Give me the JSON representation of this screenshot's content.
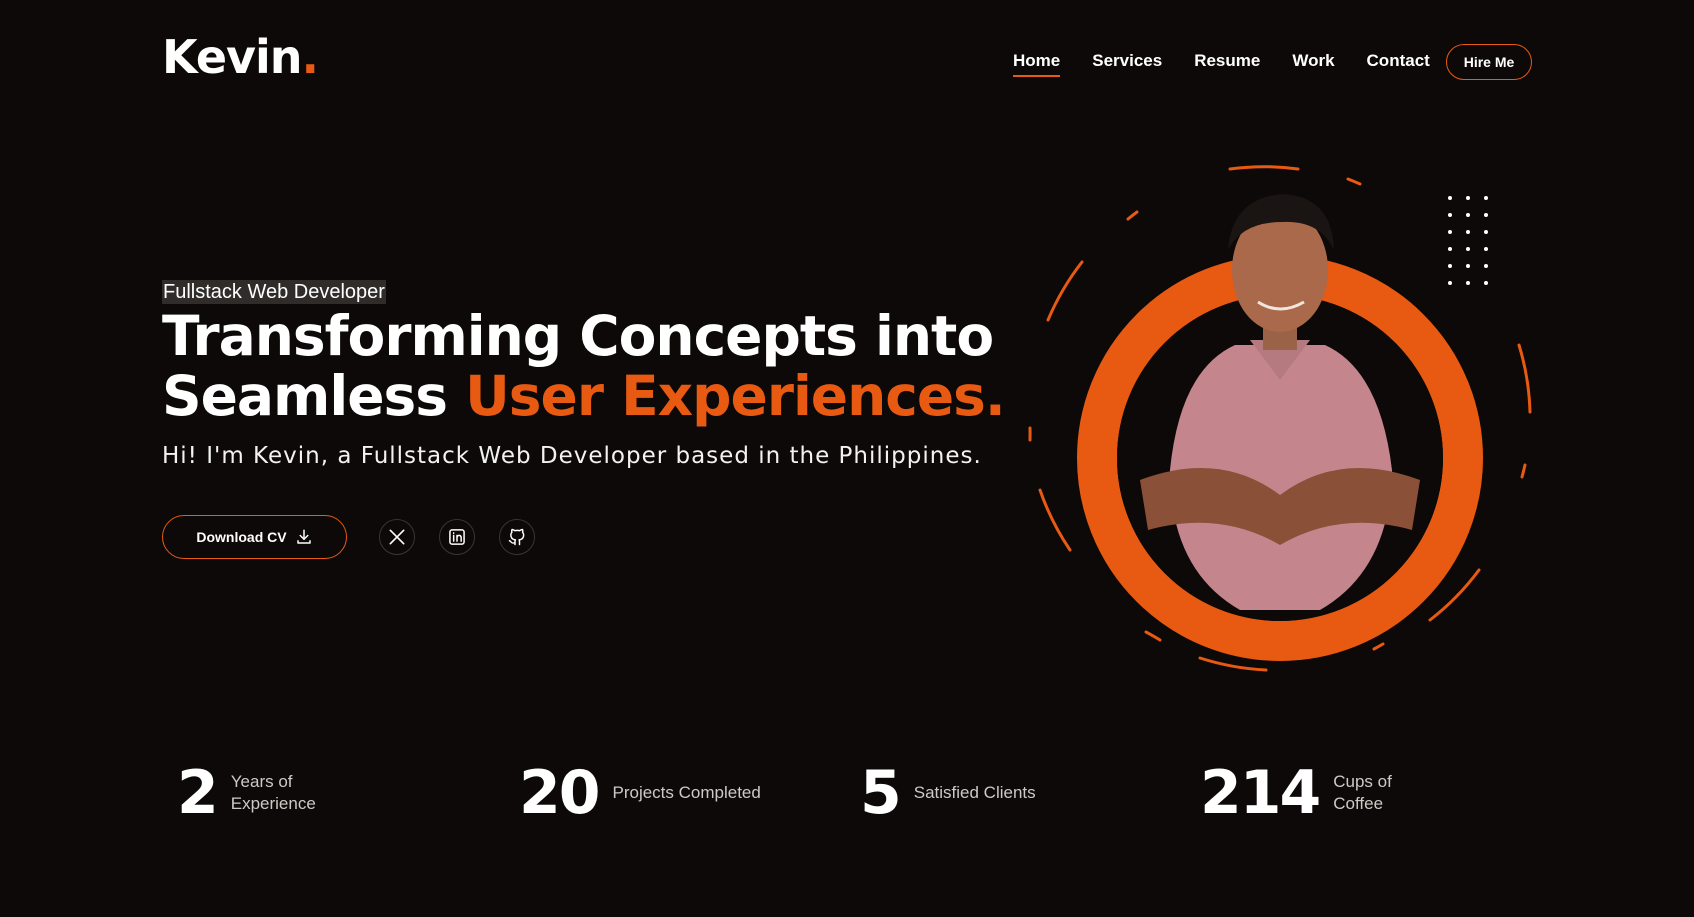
{
  "brand": {
    "name": "Kevin",
    "dot": "."
  },
  "nav": {
    "items": [
      "Home",
      "Services",
      "Resume",
      "Work",
      "Contact"
    ],
    "active": "Home",
    "cta": "Hire Me"
  },
  "hero": {
    "tag": "Fullstack Web Developer",
    "headline_line1": "Transforming Concepts into",
    "headline_line2_plain": "Seamless ",
    "headline_line2_accent": "User Experiences.",
    "subline": "Hi! I'm Kevin, a Fullstack Web Developer based in the Philippines.",
    "download_label": "Download CV",
    "socials": [
      "x-icon",
      "linkedin-icon",
      "github-icon"
    ]
  },
  "stats": [
    {
      "num": "2",
      "label_line1": "Years of",
      "label_line2": "Experience"
    },
    {
      "num": "20",
      "label_line1": "Projects Completed",
      "label_line2": ""
    },
    {
      "num": "5",
      "label_line1": "Satisfied Clients",
      "label_line2": ""
    },
    {
      "num": "214",
      "label_line1": "Cups of",
      "label_line2": "Coffee"
    }
  ],
  "colors": {
    "accent": "#e85a12",
    "background": "#0c0908",
    "text": "#ffffff"
  }
}
